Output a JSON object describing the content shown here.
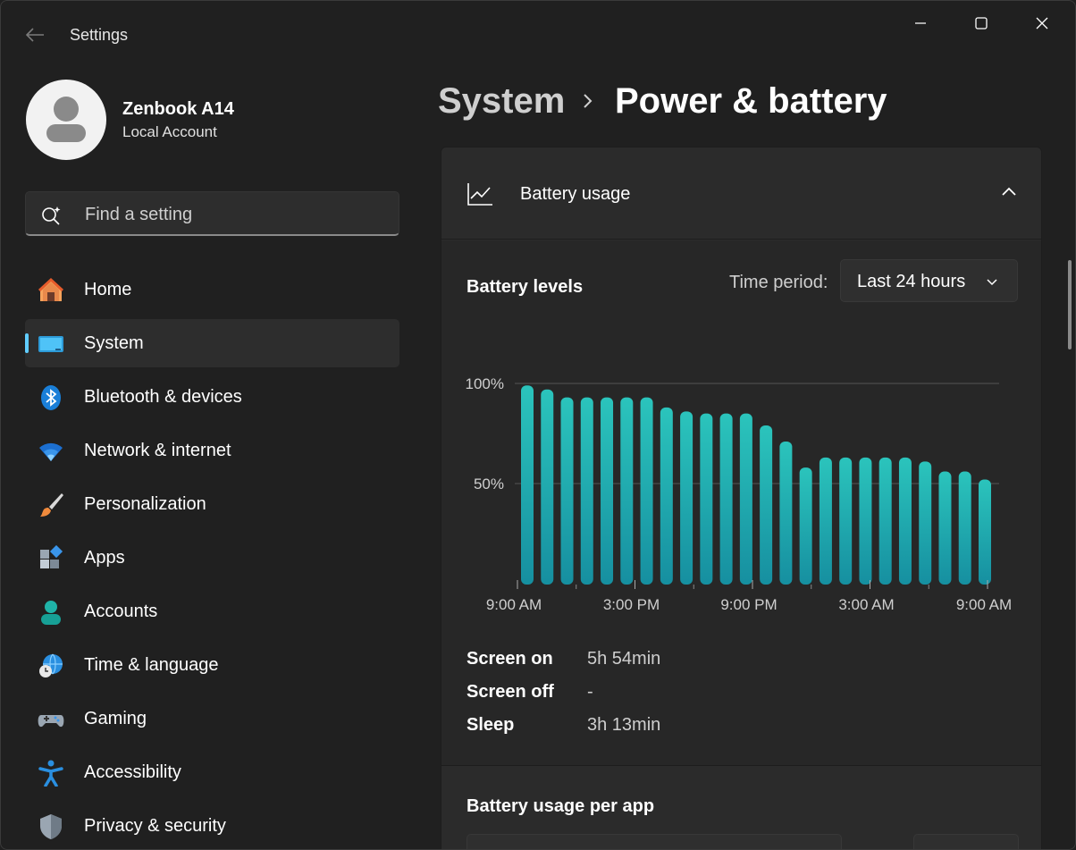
{
  "app": {
    "title": "Settings"
  },
  "profile": {
    "name": "Zenbook A14",
    "account_type": "Local Account"
  },
  "search": {
    "placeholder": "Find a setting"
  },
  "nav": {
    "items": [
      {
        "label": "Home",
        "icon": "home-icon"
      },
      {
        "label": "System",
        "icon": "system-icon",
        "active": true
      },
      {
        "label": "Bluetooth & devices",
        "icon": "bluetooth-icon"
      },
      {
        "label": "Network & internet",
        "icon": "wifi-icon"
      },
      {
        "label": "Personalization",
        "icon": "paintbrush-icon"
      },
      {
        "label": "Apps",
        "icon": "apps-icon"
      },
      {
        "label": "Accounts",
        "icon": "account-icon"
      },
      {
        "label": "Time & language",
        "icon": "globe-clock-icon"
      },
      {
        "label": "Gaming",
        "icon": "gamepad-icon"
      },
      {
        "label": "Accessibility",
        "icon": "accessibility-icon"
      },
      {
        "label": "Privacy & security",
        "icon": "shield-icon"
      }
    ]
  },
  "header": {
    "parent": "System",
    "current": "Power & battery"
  },
  "battery_usage": {
    "section_label": "Battery usage",
    "levels_title": "Battery levels",
    "time_period_label": "Time period:",
    "time_period_value": "Last 24 hours",
    "stats": [
      {
        "label": "Screen on",
        "value": "5h 54min"
      },
      {
        "label": "Screen off",
        "value": "-"
      },
      {
        "label": "Sleep",
        "value": "3h 13min"
      }
    ],
    "per_app_title": "Battery usage per app"
  },
  "chart_data": {
    "type": "bar",
    "y_tick_labels": [
      "100%",
      "50%"
    ],
    "x_tick_labels": [
      "9:00 AM",
      "3:00 PM",
      "9:00 PM",
      "3:00 AM",
      "9:00 AM"
    ],
    "ylim": [
      0,
      100
    ],
    "values": [
      99,
      97,
      93,
      93,
      93,
      93,
      93,
      88,
      86,
      85,
      85,
      85,
      79,
      71,
      58,
      63,
      63,
      63,
      63,
      63,
      61,
      56,
      56,
      52
    ],
    "bar_color": "#1fb3b0",
    "gridlines": true
  },
  "colors": {
    "accent": "#60cdff",
    "bar": "#1fb3b0"
  }
}
